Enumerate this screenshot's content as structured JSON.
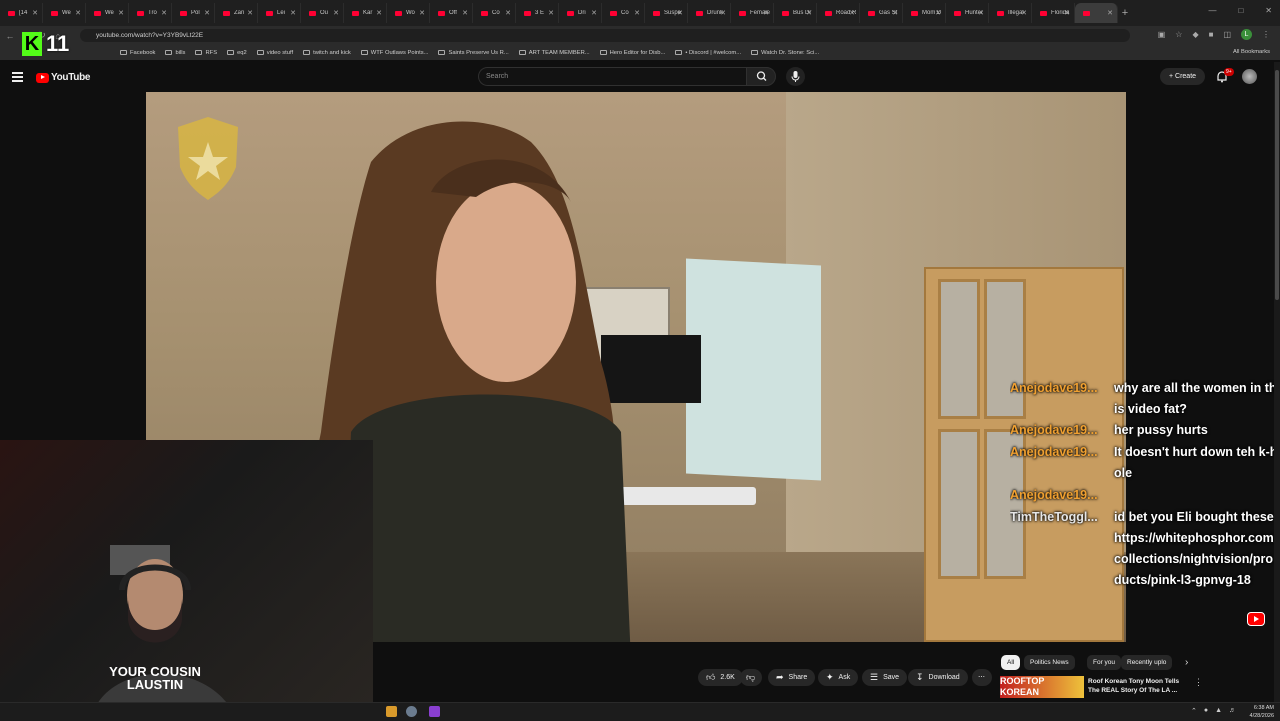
{
  "browser": {
    "tabs": [
      {
        "label": "[14"
      },
      {
        "label": "We"
      },
      {
        "label": "We"
      },
      {
        "label": "Tro"
      },
      {
        "label": "Pol"
      },
      {
        "label": "Zan"
      },
      {
        "label": "Lei"
      },
      {
        "label": "Ou"
      },
      {
        "label": "Kar"
      },
      {
        "label": "Wo"
      },
      {
        "label": "Off"
      },
      {
        "label": "Co"
      },
      {
        "label": "3 E"
      },
      {
        "label": "Dri"
      },
      {
        "label": "Co"
      },
      {
        "label": "Suspe"
      },
      {
        "label": "Drunk"
      },
      {
        "label": "Female"
      },
      {
        "label": "Bus Dr"
      },
      {
        "label": "Road R"
      },
      {
        "label": "Gas St"
      },
      {
        "label": "Mom D"
      },
      {
        "label": "Hunter"
      },
      {
        "label": "Illegal"
      },
      {
        "label": "Florida"
      },
      {
        "label": ""
      }
    ],
    "url": "youtube.com/watch?v=Y3YB9vLt22E",
    "bookmarks": [
      {
        "label": "Facebook",
        "icon": "facebook-icon"
      },
      {
        "label": "bills",
        "icon": "folder-icon"
      },
      {
        "label": "RFS",
        "icon": "folder-icon"
      },
      {
        "label": "eq2",
        "icon": "folder-icon"
      },
      {
        "label": "video stuff",
        "icon": "folder-icon"
      },
      {
        "label": "twitch and kick",
        "icon": "folder-icon"
      },
      {
        "label": "WTF Outlaws Points...",
        "icon": "sheet-icon"
      },
      {
        "label": "Saints Preserve Us R...",
        "icon": "site-icon"
      },
      {
        "label": "ART TEAM MEMBER...",
        "icon": "sheet-icon"
      },
      {
        "label": "Hero Editor for Disb...",
        "icon": "folder-icon"
      },
      {
        "label": "• Discord | #welcom...",
        "icon": "discord-icon"
      },
      {
        "label": "Watch Dr. Stone: Sci...",
        "icon": "site-icon"
      }
    ],
    "all_bookmarks": "All Bookmarks",
    "profile_initial": "L"
  },
  "overlay_logo": {
    "letter": "K",
    "number": "11"
  },
  "youtube": {
    "logo_text": "YouTube",
    "search_placeholder": "Search",
    "create_label": "Create",
    "notification_badge": "9+"
  },
  "webcam": {
    "shirt_text": "YOUR COUSIN LAUSTIN"
  },
  "chat": [
    {
      "user": "Anejodave19...",
      "text": "why are all the women in this video fat?",
      "color": "#f0a030"
    },
    {
      "user": "Anejodave19...",
      "text": "her pussy hurts",
      "color": "#f0a030"
    },
    {
      "user": "Anejodave19...",
      "text": "It doesn't hurt down teh k-hole",
      "color": "#f0a030"
    },
    {
      "user": "Anejodave19...",
      "text": "",
      "color": "#f0a030"
    },
    {
      "user": "TimTheToggl...",
      "text": "id bet you Eli bought these https://whitephosphor.com/collections/nightvision/products/pink-l3-gpnvg-18",
      "color": "#e6e6e6"
    }
  ],
  "actions": {
    "likes": "2.6K",
    "share": "Share",
    "ask": "Ask",
    "save": "Save",
    "download": "Download"
  },
  "chips": [
    "All",
    "Politics News",
    "For you",
    "Recently uplo"
  ],
  "recommendation": {
    "thumb_text": "ROOFTOP KOREAN",
    "title": "Roof Korean Tony Moon Tells The REAL Story Of The LA ..."
  },
  "taskbar": {
    "time": "6:38 AM",
    "date": "4/28/2026"
  }
}
